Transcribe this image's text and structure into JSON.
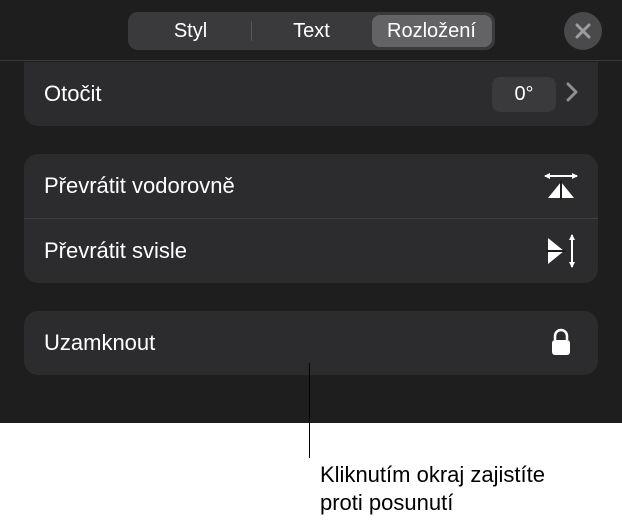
{
  "tabs": {
    "style": "Styl",
    "text": "Text",
    "layout": "Rozložení"
  },
  "rotate": {
    "label": "Otočit",
    "value": "0°"
  },
  "flip_h": {
    "label": "Převrátit vodorovně"
  },
  "flip_v": {
    "label": "Převrátit svisle"
  },
  "lock": {
    "label": "Uzamknout"
  },
  "callout": {
    "line1": "Kliknutím okraj zajistíte",
    "line2": "proti posunutí"
  }
}
